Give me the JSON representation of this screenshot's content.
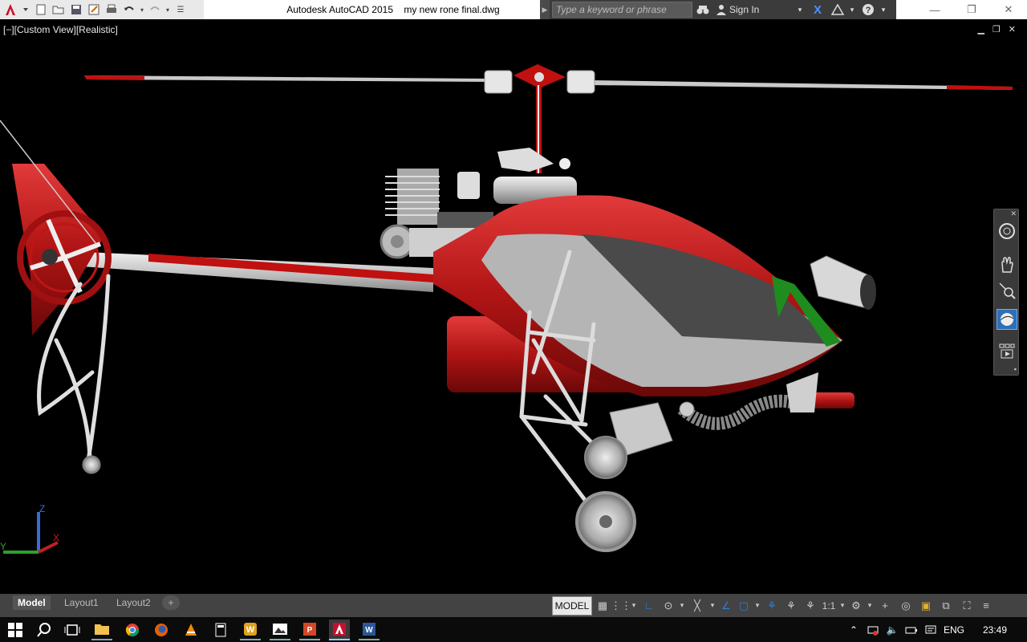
{
  "app": {
    "title": "Autodesk AutoCAD 2015    my new rone final.dwg"
  },
  "search": {
    "placeholder": "Type a keyword or phrase"
  },
  "account": {
    "sign_in": "Sign In"
  },
  "viewport": {
    "view_label": "[−][Custom View][Realistic]",
    "ucs": {
      "z": "Z",
      "y": "Y",
      "x": "X"
    }
  },
  "layout_tabs": [
    {
      "label": "Model",
      "active": true
    },
    {
      "label": "Layout1",
      "active": false
    },
    {
      "label": "Layout2",
      "active": false
    }
  ],
  "status": {
    "model": "MODEL",
    "scale": "1:1"
  },
  "tray": {
    "language": "ENG",
    "clock": "23:49"
  },
  "colors": {
    "accent": "#c8102e",
    "status_blue": "#2f7fd6",
    "viewport_bg": "#000000"
  }
}
